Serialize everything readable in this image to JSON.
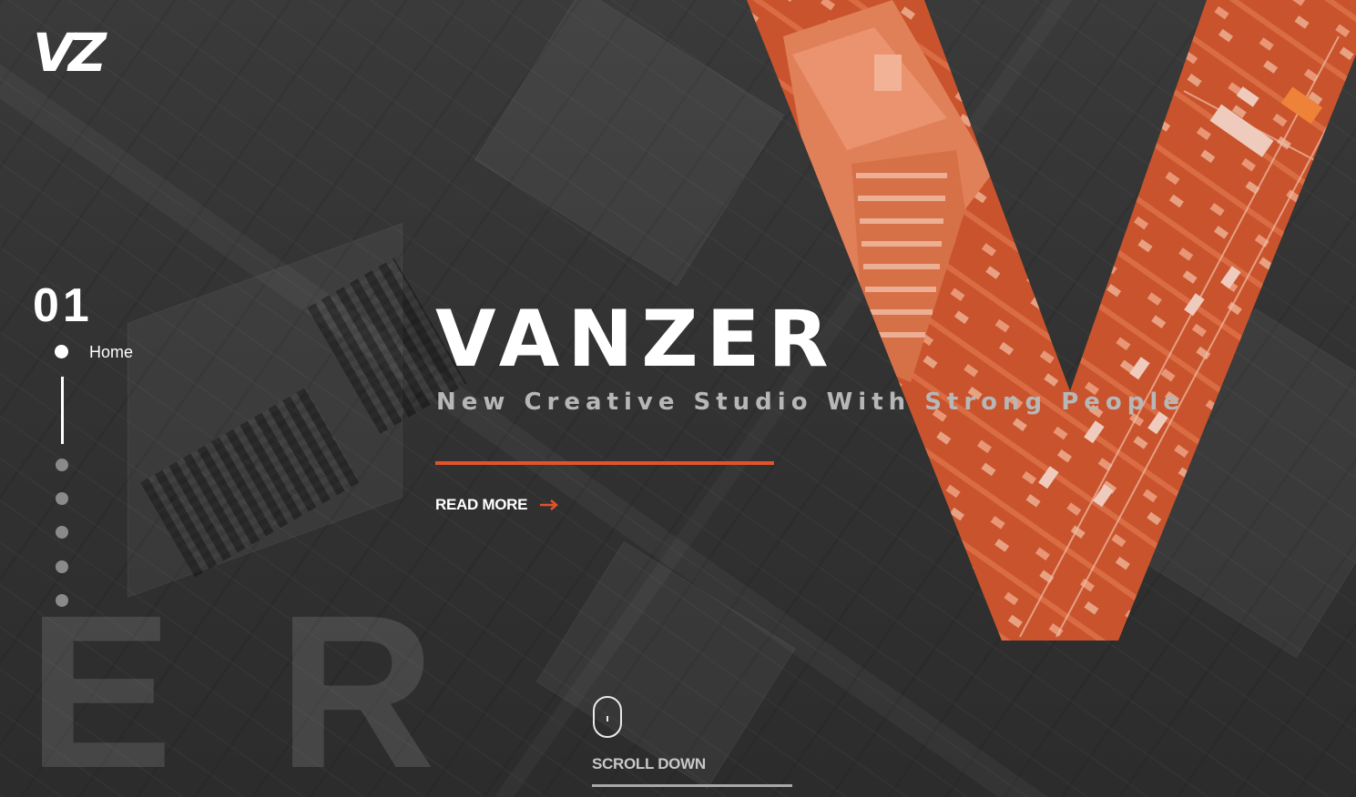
{
  "brand": {
    "logo_text": "VZ"
  },
  "slide": {
    "number": "01",
    "active_label": "Home"
  },
  "nav": {
    "dots": 6,
    "active_index": 0
  },
  "ghost_letters": [
    "E",
    "R"
  ],
  "hero": {
    "title": "VANZER",
    "subtitle": "New Creative Studio With Strong People",
    "cta_label": "READ MORE"
  },
  "scroll": {
    "label": "SCROLL DOWN"
  },
  "colors": {
    "accent": "#e2532b",
    "background": "#323232",
    "text": "#ffffff",
    "subtitle": "#b7b7b7"
  },
  "icons": {
    "cta": "arrow-right-icon",
    "scroll": "mouse-icon"
  }
}
